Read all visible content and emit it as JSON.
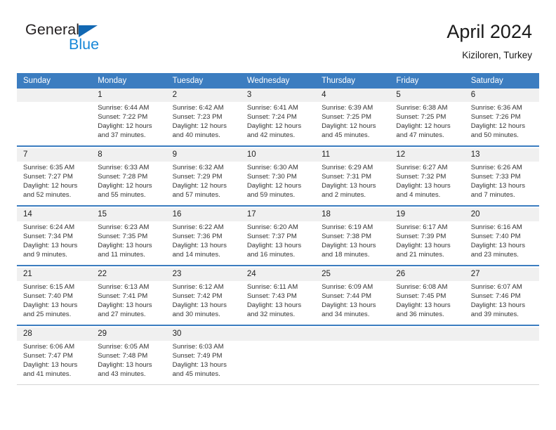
{
  "brand": {
    "name_top": "General",
    "name_bottom": "Blue",
    "triangle_icon": "blue-triangle-logo-mark",
    "color_top": "#231f20",
    "color_bottom": "#1787d8"
  },
  "header": {
    "title": "April 2024",
    "subtitle": "Kiziloren, Turkey"
  },
  "theme": {
    "header_blue": "#3c7dc0",
    "daynum_band": "#f0f0f0",
    "text": "#333333"
  },
  "calendar": {
    "weekday_headers": [
      "Sunday",
      "Monday",
      "Tuesday",
      "Wednesday",
      "Thursday",
      "Friday",
      "Saturday"
    ],
    "weeks": [
      [
        {
          "day": "",
          "sunrise": "",
          "sunset": "",
          "daylight_1": "",
          "daylight_2": ""
        },
        {
          "day": "1",
          "sunrise": "Sunrise: 6:44 AM",
          "sunset": "Sunset: 7:22 PM",
          "daylight_1": "Daylight: 12 hours",
          "daylight_2": "and 37 minutes."
        },
        {
          "day": "2",
          "sunrise": "Sunrise: 6:42 AM",
          "sunset": "Sunset: 7:23 PM",
          "daylight_1": "Daylight: 12 hours",
          "daylight_2": "and 40 minutes."
        },
        {
          "day": "3",
          "sunrise": "Sunrise: 6:41 AM",
          "sunset": "Sunset: 7:24 PM",
          "daylight_1": "Daylight: 12 hours",
          "daylight_2": "and 42 minutes."
        },
        {
          "day": "4",
          "sunrise": "Sunrise: 6:39 AM",
          "sunset": "Sunset: 7:25 PM",
          "daylight_1": "Daylight: 12 hours",
          "daylight_2": "and 45 minutes."
        },
        {
          "day": "5",
          "sunrise": "Sunrise: 6:38 AM",
          "sunset": "Sunset: 7:25 PM",
          "daylight_1": "Daylight: 12 hours",
          "daylight_2": "and 47 minutes."
        },
        {
          "day": "6",
          "sunrise": "Sunrise: 6:36 AM",
          "sunset": "Sunset: 7:26 PM",
          "daylight_1": "Daylight: 12 hours",
          "daylight_2": "and 50 minutes."
        }
      ],
      [
        {
          "day": "7",
          "sunrise": "Sunrise: 6:35 AM",
          "sunset": "Sunset: 7:27 PM",
          "daylight_1": "Daylight: 12 hours",
          "daylight_2": "and 52 minutes."
        },
        {
          "day": "8",
          "sunrise": "Sunrise: 6:33 AM",
          "sunset": "Sunset: 7:28 PM",
          "daylight_1": "Daylight: 12 hours",
          "daylight_2": "and 55 minutes."
        },
        {
          "day": "9",
          "sunrise": "Sunrise: 6:32 AM",
          "sunset": "Sunset: 7:29 PM",
          "daylight_1": "Daylight: 12 hours",
          "daylight_2": "and 57 minutes."
        },
        {
          "day": "10",
          "sunrise": "Sunrise: 6:30 AM",
          "sunset": "Sunset: 7:30 PM",
          "daylight_1": "Daylight: 12 hours",
          "daylight_2": "and 59 minutes."
        },
        {
          "day": "11",
          "sunrise": "Sunrise: 6:29 AM",
          "sunset": "Sunset: 7:31 PM",
          "daylight_1": "Daylight: 13 hours",
          "daylight_2": "and 2 minutes."
        },
        {
          "day": "12",
          "sunrise": "Sunrise: 6:27 AM",
          "sunset": "Sunset: 7:32 PM",
          "daylight_1": "Daylight: 13 hours",
          "daylight_2": "and 4 minutes."
        },
        {
          "day": "13",
          "sunrise": "Sunrise: 6:26 AM",
          "sunset": "Sunset: 7:33 PM",
          "daylight_1": "Daylight: 13 hours",
          "daylight_2": "and 7 minutes."
        }
      ],
      [
        {
          "day": "14",
          "sunrise": "Sunrise: 6:24 AM",
          "sunset": "Sunset: 7:34 PM",
          "daylight_1": "Daylight: 13 hours",
          "daylight_2": "and 9 minutes."
        },
        {
          "day": "15",
          "sunrise": "Sunrise: 6:23 AM",
          "sunset": "Sunset: 7:35 PM",
          "daylight_1": "Daylight: 13 hours",
          "daylight_2": "and 11 minutes."
        },
        {
          "day": "16",
          "sunrise": "Sunrise: 6:22 AM",
          "sunset": "Sunset: 7:36 PM",
          "daylight_1": "Daylight: 13 hours",
          "daylight_2": "and 14 minutes."
        },
        {
          "day": "17",
          "sunrise": "Sunrise: 6:20 AM",
          "sunset": "Sunset: 7:37 PM",
          "daylight_1": "Daylight: 13 hours",
          "daylight_2": "and 16 minutes."
        },
        {
          "day": "18",
          "sunrise": "Sunrise: 6:19 AM",
          "sunset": "Sunset: 7:38 PM",
          "daylight_1": "Daylight: 13 hours",
          "daylight_2": "and 18 minutes."
        },
        {
          "day": "19",
          "sunrise": "Sunrise: 6:17 AM",
          "sunset": "Sunset: 7:39 PM",
          "daylight_1": "Daylight: 13 hours",
          "daylight_2": "and 21 minutes."
        },
        {
          "day": "20",
          "sunrise": "Sunrise: 6:16 AM",
          "sunset": "Sunset: 7:40 PM",
          "daylight_1": "Daylight: 13 hours",
          "daylight_2": "and 23 minutes."
        }
      ],
      [
        {
          "day": "21",
          "sunrise": "Sunrise: 6:15 AM",
          "sunset": "Sunset: 7:40 PM",
          "daylight_1": "Daylight: 13 hours",
          "daylight_2": "and 25 minutes."
        },
        {
          "day": "22",
          "sunrise": "Sunrise: 6:13 AM",
          "sunset": "Sunset: 7:41 PM",
          "daylight_1": "Daylight: 13 hours",
          "daylight_2": "and 27 minutes."
        },
        {
          "day": "23",
          "sunrise": "Sunrise: 6:12 AM",
          "sunset": "Sunset: 7:42 PM",
          "daylight_1": "Daylight: 13 hours",
          "daylight_2": "and 30 minutes."
        },
        {
          "day": "24",
          "sunrise": "Sunrise: 6:11 AM",
          "sunset": "Sunset: 7:43 PM",
          "daylight_1": "Daylight: 13 hours",
          "daylight_2": "and 32 minutes."
        },
        {
          "day": "25",
          "sunrise": "Sunrise: 6:09 AM",
          "sunset": "Sunset: 7:44 PM",
          "daylight_1": "Daylight: 13 hours",
          "daylight_2": "and 34 minutes."
        },
        {
          "day": "26",
          "sunrise": "Sunrise: 6:08 AM",
          "sunset": "Sunset: 7:45 PM",
          "daylight_1": "Daylight: 13 hours",
          "daylight_2": "and 36 minutes."
        },
        {
          "day": "27",
          "sunrise": "Sunrise: 6:07 AM",
          "sunset": "Sunset: 7:46 PM",
          "daylight_1": "Daylight: 13 hours",
          "daylight_2": "and 39 minutes."
        }
      ],
      [
        {
          "day": "28",
          "sunrise": "Sunrise: 6:06 AM",
          "sunset": "Sunset: 7:47 PM",
          "daylight_1": "Daylight: 13 hours",
          "daylight_2": "and 41 minutes."
        },
        {
          "day": "29",
          "sunrise": "Sunrise: 6:05 AM",
          "sunset": "Sunset: 7:48 PM",
          "daylight_1": "Daylight: 13 hours",
          "daylight_2": "and 43 minutes."
        },
        {
          "day": "30",
          "sunrise": "Sunrise: 6:03 AM",
          "sunset": "Sunset: 7:49 PM",
          "daylight_1": "Daylight: 13 hours",
          "daylight_2": "and 45 minutes."
        },
        {
          "day": "",
          "sunrise": "",
          "sunset": "",
          "daylight_1": "",
          "daylight_2": ""
        },
        {
          "day": "",
          "sunrise": "",
          "sunset": "",
          "daylight_1": "",
          "daylight_2": ""
        },
        {
          "day": "",
          "sunrise": "",
          "sunset": "",
          "daylight_1": "",
          "daylight_2": ""
        },
        {
          "day": "",
          "sunrise": "",
          "sunset": "",
          "daylight_1": "",
          "daylight_2": ""
        }
      ]
    ]
  }
}
